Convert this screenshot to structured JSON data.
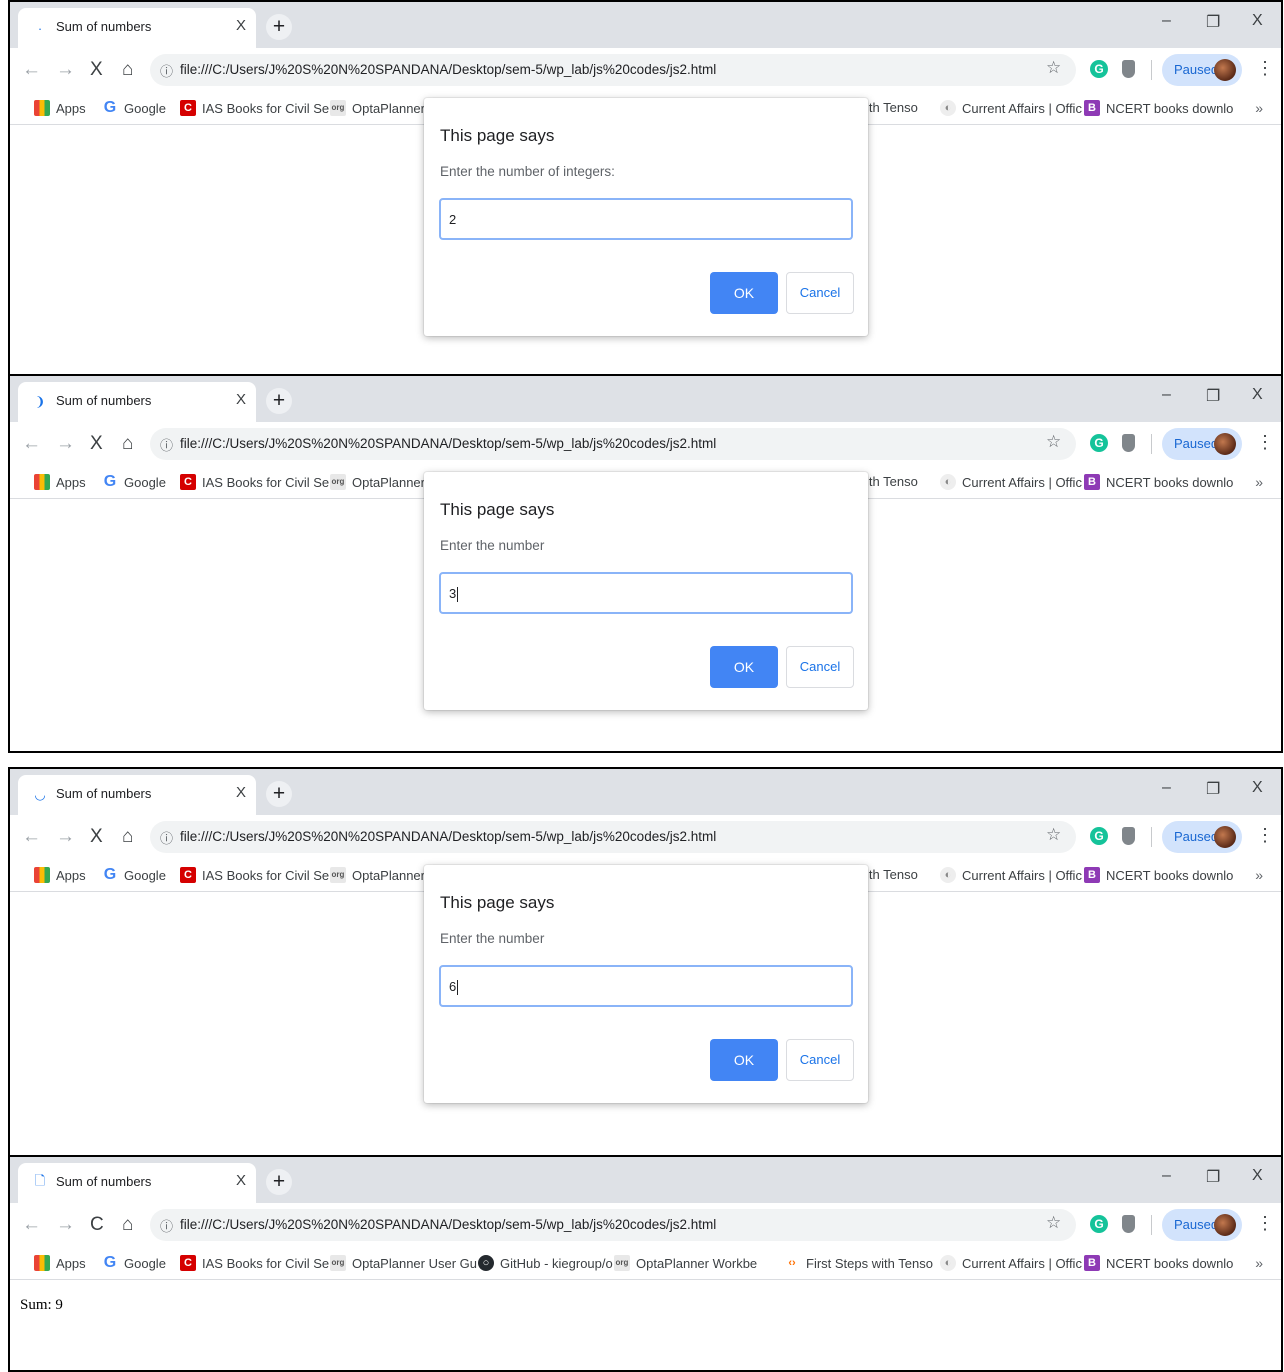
{
  "browser": {
    "tab_title": "Sum of numbers",
    "tab_close_glyph": "X",
    "new_tab_glyph": "+",
    "url": "file:///C:/Users/J%20S%20N%20SPANDANA/Desktop/sem-5/wp_lab/js%20codes/js2.html",
    "info_glyph": "ⓘ",
    "profile_label": "Paused",
    "grammarly_letter": "G",
    "window_controls": {
      "minimize": "–",
      "restore": "❐",
      "close": "X"
    },
    "nav": {
      "back": "←",
      "forward": "→",
      "stop": "X",
      "reload": "C",
      "home": "⌂",
      "star": "☆",
      "menu": "⋮"
    },
    "more_bookmarks": "»"
  },
  "bookmarks": [
    {
      "label": "Apps",
      "icon": "apps-grid-icon"
    },
    {
      "label": "Google",
      "icon": "google-g-icon",
      "glyph": "G"
    },
    {
      "label": "IAS Books for Civil Se",
      "icon": "ias-c-icon",
      "glyph": "C"
    },
    {
      "label": "OptaPlanner User Gu",
      "label_cut": "OptaPlanner U",
      "icon": "org-logo-icon",
      "glyph": "org"
    },
    {
      "label": "GitHub - kiegroup/o",
      "icon": "github-icon",
      "glyph": "○"
    },
    {
      "label": "OptaPlanner Workbe",
      "icon": "org-logo-icon",
      "glyph": "org"
    },
    {
      "label": "First Steps with Tenso",
      "label_cut": "ith Tenso",
      "icon": "tensorflow-icon",
      "glyph": "‹›"
    },
    {
      "label": "Current Affairs | Offic",
      "icon": "current-affairs-icon",
      "glyph": "◐"
    },
    {
      "label": "NCERT books downlo",
      "icon": "ncert-icon",
      "glyph": "B"
    }
  ],
  "dialog": {
    "title": "This page says",
    "ok_label": "OK",
    "cancel_label": "Cancel"
  },
  "frames": [
    {
      "favicon": "·",
      "favicon_icon": "loading-dot-icon",
      "dialog_message": "Enter the number of integers:",
      "input_value": "2",
      "caret": false,
      "loading": true
    },
    {
      "favicon": "❩",
      "favicon_icon": "loading-spinner-icon",
      "dialog_message": "Enter the number",
      "input_value": "3",
      "caret": true,
      "loading": true
    },
    {
      "favicon": "◡",
      "favicon_icon": "loading-spinner-icon",
      "dialog_message": "Enter the number",
      "input_value": "6",
      "caret": true,
      "loading": true
    },
    {
      "favicon": "🗋",
      "favicon_icon": "page-icon",
      "page_text": "Sum: 9",
      "loading": false
    }
  ],
  "colors": {
    "accent": "#4285f4",
    "tabbar": "#dee1e6",
    "profile_bg": "#d2e3fc"
  }
}
